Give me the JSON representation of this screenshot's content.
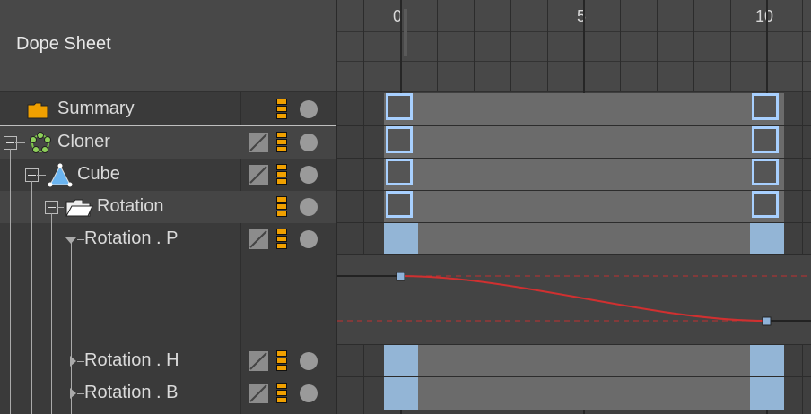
{
  "panel": {
    "title": "Dope Sheet"
  },
  "ruler": {
    "labels": [
      "0",
      "5",
      "10"
    ]
  },
  "tracks": [
    {
      "name": "Summary"
    },
    {
      "name": "Cloner"
    },
    {
      "name": "Cube"
    },
    {
      "name": "Rotation"
    },
    {
      "name": "Rotation . P"
    },
    {
      "name": "Rotation . H"
    },
    {
      "name": "Rotation . B"
    }
  ],
  "colors": {
    "layer_orange": "#f0a000",
    "keyframe_outline": "#a8d0ff",
    "keyframe_fill": "#93b5d6",
    "curve_red": "#d03030"
  },
  "icons": {
    "summary": "folder-icon",
    "cloner": "cloner-icon",
    "cube": "cube-icon",
    "rotation": "open-folder-icon"
  }
}
